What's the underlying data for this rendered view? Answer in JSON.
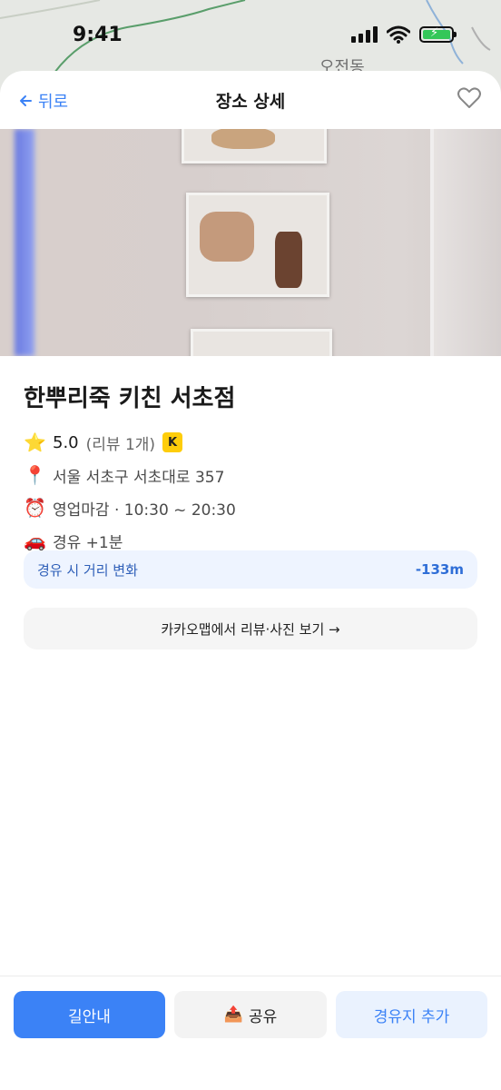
{
  "status_bar": {
    "time": "9:41"
  },
  "map": {
    "area_label": "오전동"
  },
  "header": {
    "back_label": "뒤로",
    "title": "장소 상세"
  },
  "place": {
    "name": "한뿌리죽 키친 서초점",
    "rating": "5.0",
    "review_count": "(리뷰 1개)",
    "badge": "K",
    "address": "서울 서초구 서초대로 357",
    "hours": "영업마감 · 10:30 ~ 20:30",
    "detour": "경유 +1분"
  },
  "distance_change": {
    "label": "경유 시 거리 변화",
    "value": "-133m"
  },
  "kakao_link": {
    "label": "카카오맵에서 리뷰·사진 보기 →"
  },
  "actions": {
    "navigate": "길안내",
    "share": "공유",
    "add_waypoint": "경유지 추가"
  },
  "icons": {
    "back": "arrow-left-icon",
    "favorite": "heart-icon",
    "rating": "star-icon",
    "address": "pin-icon",
    "hours": "alarm-clock-icon",
    "detour": "car-icon",
    "share": "share-tray-icon"
  },
  "colors": {
    "accent": "#3b82f6",
    "badge": "#fecd0a",
    "distance_bg": "#eef4ff"
  }
}
